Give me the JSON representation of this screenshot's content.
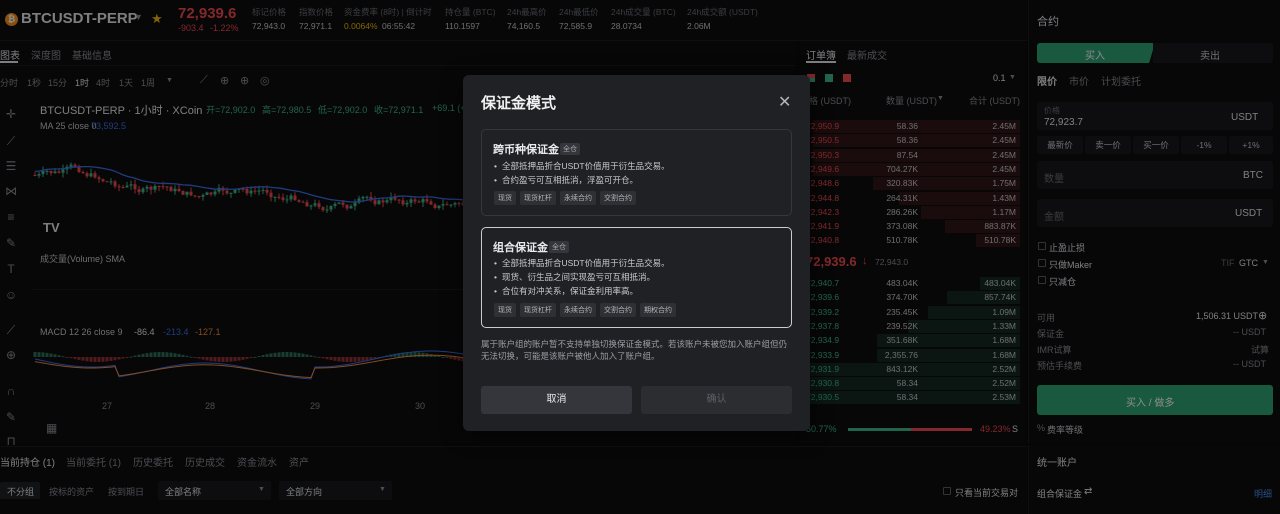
{
  "header": {
    "symbol": "BTCUSDT-PERP",
    "last_price": "72,939.6",
    "change": "-903.4",
    "change_pct": "-1.22%",
    "stats": [
      {
        "label": "标记价格",
        "value": "72,943.0"
      },
      {
        "label": "指数价格",
        "value": "72,971.1"
      },
      {
        "label": "资金费率 (8时) | 倒计时",
        "value": "0.0064%",
        "value2": "06:55:42"
      },
      {
        "label": "持仓量 (BTC)",
        "value": "110.1597"
      },
      {
        "label": "24h最高价",
        "value": "74,160.5"
      },
      {
        "label": "24h最低价",
        "value": "72,585.9"
      },
      {
        "label": "24h成交量 (BTC)",
        "value": "28.0734"
      },
      {
        "label": "24h成交额 (USDT)",
        "value": "2.06M"
      }
    ]
  },
  "chart": {
    "tabs": [
      "图表",
      "深度图",
      "基础信息"
    ],
    "intervals": [
      "分时",
      "1秒",
      "15分",
      "1时",
      "4时",
      "1天",
      "1周"
    ],
    "title": "BTCUSDT-PERP · 1小时 · XCoin",
    "ohlc": {
      "open": "开=72,902.0",
      "high": "高=72,980.5",
      "low": "低=72,902.0",
      "close": "收=72,971.1",
      "chg": "+69.1 (+"
    },
    "ma_label": "MA 25 close 0",
    "ma_value": "73,592.5",
    "volume_label": "成交量(Volume) SMA",
    "macd_label": "MACD 12 26 close 9",
    "macd_values": [
      "-86.4",
      "-213.4",
      "-127.1"
    ],
    "x_ticks": [
      "27",
      "28",
      "29",
      "30"
    ]
  },
  "orderbook": {
    "tabs": [
      "订单簿",
      "最新成交"
    ],
    "precision": "0.1",
    "columns": [
      "价格 (USDT)",
      "数量 (USDT)",
      "合计 (USDT)"
    ],
    "asks": [
      [
        "72,950.9",
        "58.36",
        "2.45M"
      ],
      [
        "72,950.5",
        "58.36",
        "2.45M"
      ],
      [
        "72,950.3",
        "87.54",
        "2.45M"
      ],
      [
        "72,949.6",
        "704.27K",
        "2.45M"
      ],
      [
        "72,948.6",
        "320.83K",
        "1.75M"
      ],
      [
        "72,944.8",
        "264.31K",
        "1.43M"
      ],
      [
        "72,942.3",
        "286.26K",
        "1.17M"
      ],
      [
        "72,941.9",
        "373.08K",
        "883.87K"
      ],
      [
        "72,940.8",
        "510.78K",
        "510.78K"
      ]
    ],
    "mid_price": "72,939.6",
    "mid_mark": "72,943.0",
    "bids": [
      [
        "72,940.7",
        "483.04K",
        "483.04K"
      ],
      [
        "72,939.6",
        "374.70K",
        "857.74K"
      ],
      [
        "72,939.2",
        "235.45K",
        "1.09M"
      ],
      [
        "72,937.8",
        "239.52K",
        "1.33M"
      ],
      [
        "72,934.9",
        "351.68K",
        "1.68M"
      ],
      [
        "72,933.9",
        "2,355.76",
        "1.68M"
      ],
      [
        "72,931.9",
        "843.12K",
        "2.52M"
      ],
      [
        "72,930.8",
        "58.34",
        "2.52M"
      ],
      [
        "72,930.5",
        "58.34",
        "2.53M"
      ]
    ],
    "buy_ratio": "50.77%",
    "sell_ratio": "49.23%",
    "buy_fraction": 0.5077
  },
  "trade": {
    "title": "合约",
    "buy_tab": "买入",
    "sell_tab": "卖出",
    "order_types": [
      "限价",
      "市价",
      "计划委托"
    ],
    "price_label": "价格",
    "price_value": "72,923.7",
    "unit": "USDT",
    "quick": [
      "最新价",
      "卖一价",
      "买一价",
      "-1%",
      "+1%"
    ],
    "qty_placeholder": "数量",
    "qty_unit": "BTC",
    "amount_placeholder": "金额",
    "amount_unit": "USDT",
    "tpsl": "止盈止损",
    "maker_only": "只做Maker",
    "tif": "TIF",
    "tif_value": "GTC",
    "reduce_only": "只减仓",
    "available_label": "可用",
    "available_value": "1,506.31 USDT",
    "margin_label": "保证金",
    "margin_value": "-- USDT",
    "imr_label": "IMR试算",
    "imr_value": "试算",
    "fee_label": "预估手续费",
    "fee_value": "-- USDT",
    "submit": "买入 / 做多",
    "fee_level": "费率等级"
  },
  "bottom": {
    "tabs": [
      "当前持仓 (1)",
      "当前委托 (1)",
      "历史委托",
      "历史成交",
      "资金流水",
      "资产"
    ],
    "filters": [
      "不分组",
      "按标的资产",
      "按到期日"
    ],
    "dropdown1": "全部名称",
    "dropdown2": "全部方向",
    "only_current": "只看当前交易对"
  },
  "account": {
    "title": "统一账户",
    "margin_mode": "组合保证金",
    "detail": "明细"
  },
  "modal": {
    "title": "保证金模式",
    "option1": {
      "title": "跨币种保证金",
      "badge": "全仓",
      "bullets": [
        "全部抵押品折合USDT价值用于衍生品交易。",
        "合约盈亏可互相抵消，浮盈可开仓。"
      ],
      "tags": [
        "现货",
        "现货杠杆",
        "永续合约",
        "交割合约"
      ]
    },
    "option2": {
      "title": "组合保证金",
      "badge": "全仓",
      "bullets": [
        "全部抵押品折合USDT价值用于衍生品交易。",
        "现货、衍生品之间实现盈亏可互相抵消。",
        "合位有对冲关系，保证金利用率高。"
      ],
      "tags": [
        "现货",
        "现货杠杆",
        "永续合约",
        "交割合约",
        "期权合约"
      ]
    },
    "note": "属于账户组的账户暂不支持单独切换保证金模式。若该账户未被您加入账户组但仍无法切换，可能是该账户被他人加入了账户组。",
    "cancel": "取消",
    "confirm": "确认"
  },
  "colors": {
    "up": "#3fb68b",
    "down": "#f0494f",
    "accent": "#2ea275"
  }
}
